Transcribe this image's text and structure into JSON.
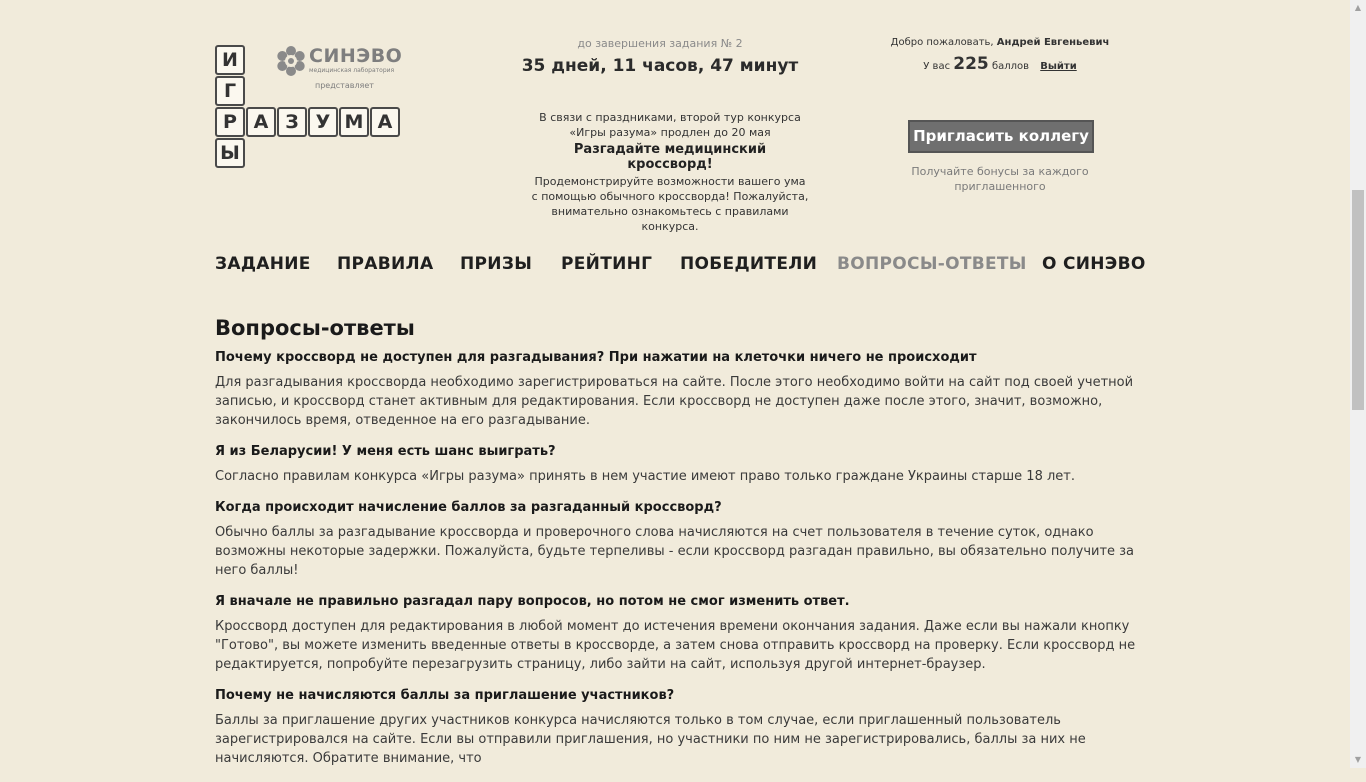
{
  "logo": {
    "tiles": [
      "И",
      "Г",
      "Р",
      "А",
      "З",
      "У",
      "М",
      "А",
      "Ы"
    ],
    "brand": "СИНЭВО",
    "brand_sub": "медицинская лаборатория",
    "presents": "представляет"
  },
  "countdown": {
    "label": "до завершения задания № 2",
    "time": "35 дней, 11 часов, 47 минут"
  },
  "notice": {
    "line1": "В связи с праздниками, второй тур конкурса «Игры разума» продлен до 20 мая",
    "headline": "Разгадайте медицинский кроссворд!",
    "body": "Продемонстрируйте возможности вашего ума с помощью обычного кроссворда! Пожалуйста, внимательно ознакомьтесь с правилами конкурса."
  },
  "user": {
    "welcome": "Добро пожаловать,",
    "name": "Андрей Евгеньевич",
    "points_prefix": "У вас",
    "points": "225",
    "points_suffix": "баллов",
    "logout": "Выйти"
  },
  "invite": {
    "button": "Пригласить коллегу",
    "note": "Получайте бонусы за каждого приглашенного"
  },
  "nav": {
    "items": [
      "ЗАДАНИЕ",
      "ПРАВИЛА",
      "ПРИЗЫ",
      "РЕЙТИНГ",
      "ПОБЕДИТЕЛИ",
      "ВОПРОСЫ-ОТВЕТЫ",
      "О СИНЭВО"
    ],
    "active": "ВОПРОСЫ-ОТВЕТЫ"
  },
  "content": {
    "title": "Вопросы-ответы",
    "faq": [
      {
        "q": "Почему кроссворд не доступен для разгадывания? При нажатии на клеточки ничего не происходит",
        "a": "Для разгадывания кроссворда необходимо зарегистрироваться на сайте. После этого необходимо войти на сайт под своей учетной записью, и кроссворд станет активным для редактирования. Если кроссворд не доступен даже после этого, значит, возможно, закончилось время, отведенное на его разгадывание."
      },
      {
        "q": "Я из Беларусии! У меня есть шанс выиграть?",
        "a": "Согласно правилам конкурса «Игры разума» принять в нем участие имеют право только граждане Украины старше 18 лет."
      },
      {
        "q": "Когда происходит начисление баллов за разгаданный кроссворд?",
        "a": "Обычно баллы за разгадывание кроссворда и проверочного слова начисляются на счет пользователя в течение суток, однако возможны некоторые задержки. Пожалуйста, будьте терпеливы - если кроссворд разгадан правильно, вы обязательно получите за него баллы!"
      },
      {
        "q": "Я вначале не правильно разгадал пару вопросов, но потом не смог изменить ответ.",
        "a": "Кроссворд доступен для редактирования в любой момент до истечения времени окончания задания. Даже если вы нажали кнопку \"Готово\", вы можете изменить введенные ответы в кроссворде, а затем снова отправить кроссворд на проверку. Если кроссворд не редактируется, попробуйте перезагрузить страницу, либо зайти на сайт, используя другой интернет-браузер."
      },
      {
        "q": "Почему не начисляются баллы за приглашение участников?",
        "a": "Баллы за приглашение других участников конкурса начисляются только в том случае, если приглашенный пользователь зарегистрировался на сайте. Если вы отправили приглашения, но участники по ним не зарегистрировались, баллы за них не начисляются. Обратите внимание, что"
      }
    ]
  },
  "colors": {
    "background": "#f1ebdb",
    "accent_gray": "#6f6f6f",
    "active_nav": "#8a8a8a"
  }
}
